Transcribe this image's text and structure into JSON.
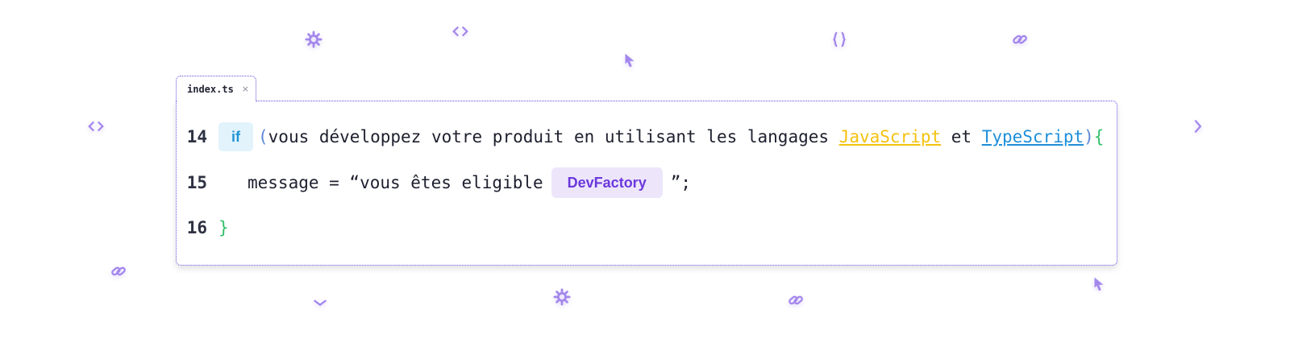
{
  "tab": {
    "filename": "index.ts",
    "close_glyph": "×"
  },
  "editor": {
    "lines": [
      {
        "number": "14",
        "keyword": "if",
        "open_paren": "(",
        "text": "vous développez votre produit en utilisant les langages ",
        "link_js": "JavaScript",
        "mid": " et ",
        "link_ts": "TypeScript",
        "close_paren": ")",
        "open_brace": "{"
      },
      {
        "number": "15",
        "text_before": "message = “vous êtes eligible",
        "badge": "DevFactory",
        "text_after": "”;"
      },
      {
        "number": "16",
        "close_brace": "}"
      }
    ]
  },
  "colors": {
    "border": "#6d4de0",
    "keyword_bg": "#e3f3fc",
    "keyword_fg": "#1f95d4",
    "javascript": "#f4c20d",
    "typescript": "#1e8fd9",
    "brace": "#34c06a",
    "badge_bg": "#ede6fb",
    "badge_fg": "#6c38dc",
    "decoration": "#9b7bea"
  },
  "decorations": [
    "gear-icon",
    "code-icon",
    "cursor-icon",
    "braces-icon",
    "link-icon",
    "code-icon",
    "chevron-icon",
    "link-icon",
    "chevron-icon",
    "gear-icon",
    "link-icon",
    "cursor-icon"
  ]
}
